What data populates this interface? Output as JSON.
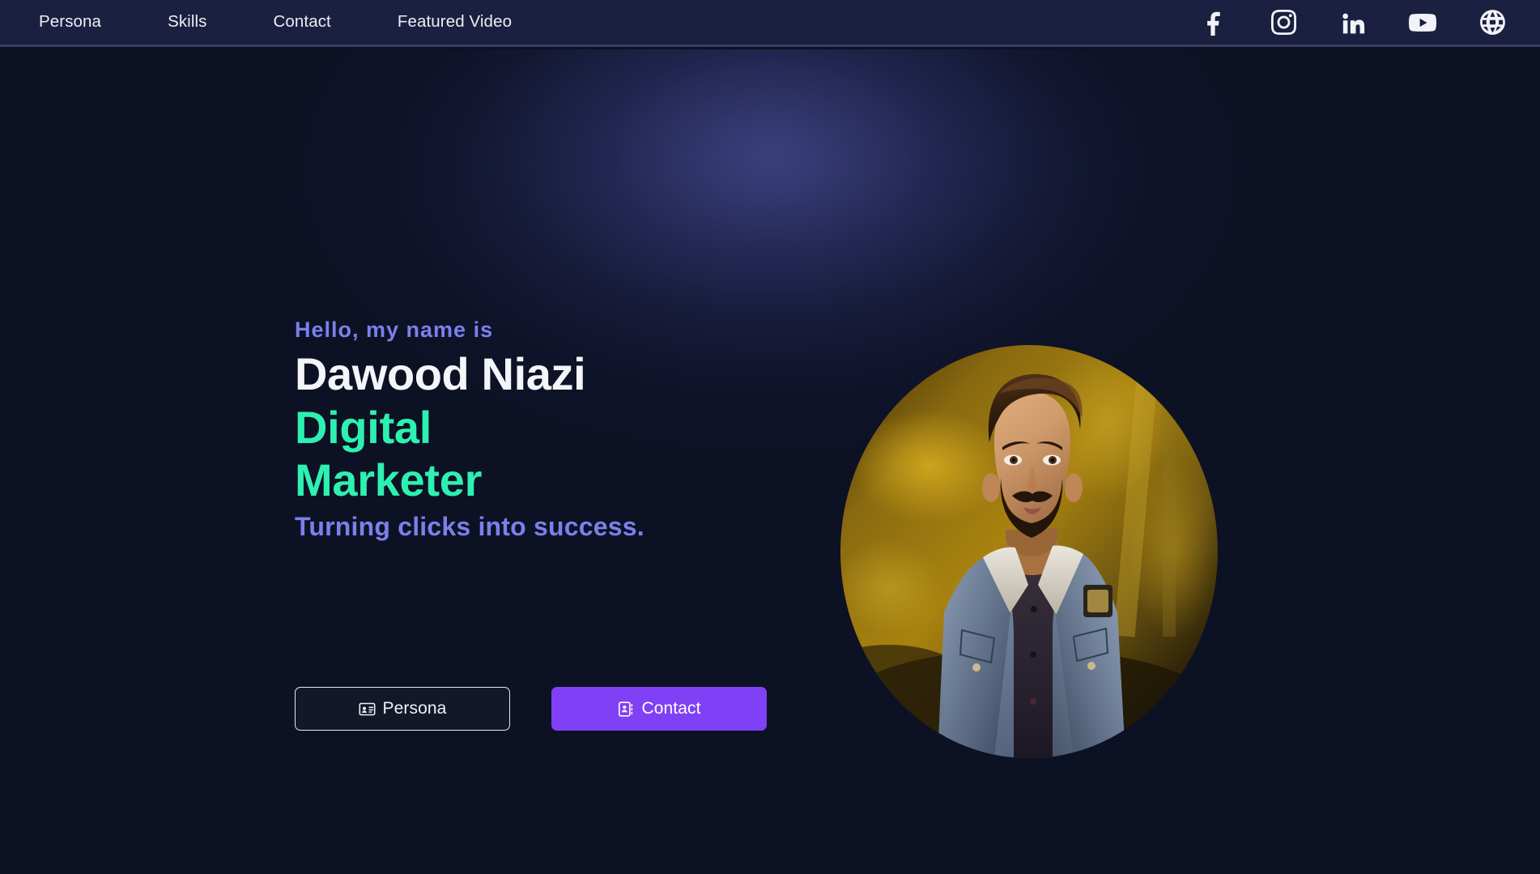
{
  "navbar": {
    "links": [
      {
        "label": "Persona"
      },
      {
        "label": "Skills"
      },
      {
        "label": "Contact"
      },
      {
        "label": "Featured Video"
      }
    ],
    "social": [
      {
        "name": "facebook-icon",
        "label": "Facebook"
      },
      {
        "name": "instagram-icon",
        "label": "Instagram"
      },
      {
        "name": "linkedin-icon",
        "label": "LinkedIn"
      },
      {
        "name": "youtube-icon",
        "label": "YouTube"
      },
      {
        "name": "website-globe-icon",
        "label": "Website"
      }
    ]
  },
  "hero": {
    "greeting": "Hello, my name is",
    "name": "Dawood Niazi",
    "role": "Digital Marketer",
    "tagline": "Turning clicks into success.",
    "buttons": {
      "persona": "Persona",
      "contact": "Contact"
    },
    "portrait_alt": "Portrait of Dawood Niazi in a denim jacket"
  },
  "colors": {
    "page_background": "#0d1124",
    "navbar_background": "#1b2040",
    "navbar_border": "#3a3f63",
    "accent_purple": "#7b80eb",
    "accent_green": "#2ef0b0",
    "button_purple": "#8040f5",
    "text_white": "#f4f5f8",
    "glow_purple": "#464c96"
  }
}
